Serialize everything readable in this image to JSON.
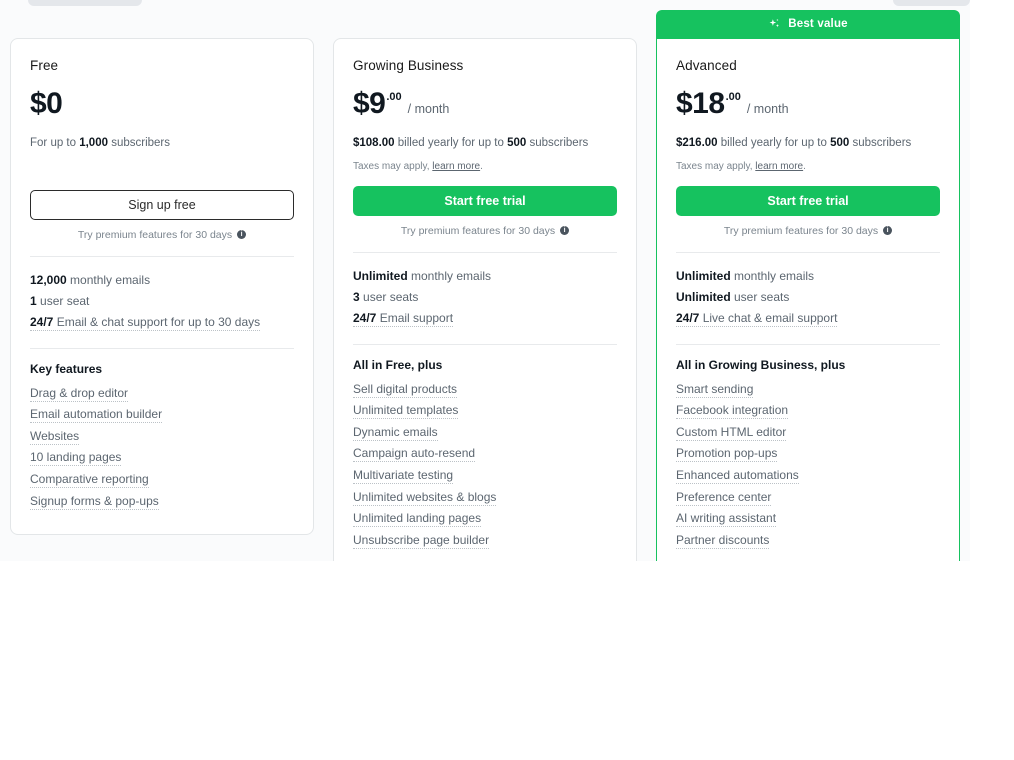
{
  "banner": {
    "label": "Best value",
    "icon": "sparkle-icon",
    "color": "#16c25f"
  },
  "info_icon_glyph": "i",
  "plans": [
    {
      "name": "Free",
      "price_main": "$0",
      "price_cents": "",
      "price_period": "",
      "billing_note_parts": {
        "prefix": "For up to ",
        "amount": "1,000",
        "suffix": " subscribers"
      },
      "tax_note": null,
      "cta_label": "Sign up free",
      "cta_style": "outline",
      "trial_note": "Try premium features for 30 days",
      "specs": [
        {
          "strong": "12,000",
          "rest": " monthly emails",
          "dotted": false
        },
        {
          "strong": "1",
          "rest": " user seat",
          "dotted": false
        },
        {
          "strong": "24/7",
          "rest": " Email & chat support for up to 30 days",
          "dotted": true
        }
      ],
      "features_title": "Key features",
      "features": [
        "Drag & drop editor",
        "Email automation builder",
        "Websites",
        "10 landing pages",
        "Comparative reporting",
        "Signup forms & pop-ups"
      ]
    },
    {
      "name": "Growing Business",
      "price_main": "$9",
      "price_cents": ".00",
      "price_period": "/ month",
      "billing_note_parts": {
        "prefix": "",
        "amount": "$108.00",
        "mid": " billed yearly for up to ",
        "amount2": "500",
        "suffix": " subscribers"
      },
      "tax_note": {
        "text": "Taxes may apply, ",
        "link": "learn more",
        "period": "."
      },
      "cta_label": "Start free trial",
      "cta_style": "solid",
      "trial_note": "Try premium features for 30 days",
      "specs": [
        {
          "strong": "Unlimited",
          "rest": " monthly emails",
          "dotted": false
        },
        {
          "strong": "3",
          "rest": " user seats",
          "dotted": false
        },
        {
          "strong": "24/7",
          "rest": " Email support",
          "dotted": true
        }
      ],
      "features_title": "All in Free, plus",
      "features": [
        "Sell digital products",
        "Unlimited templates",
        "Dynamic emails",
        "Campaign auto-resend",
        "Multivariate testing",
        "Unlimited websites & blogs",
        "Unlimited landing pages",
        "Unsubscribe page builder"
      ]
    },
    {
      "name": "Advanced",
      "price_main": "$18",
      "price_cents": ".00",
      "price_period": "/ month",
      "billing_note_parts": {
        "prefix": "",
        "amount": "$216.00",
        "mid": " billed yearly for up to ",
        "amount2": "500",
        "suffix": " subscribers"
      },
      "tax_note": {
        "text": "Taxes may apply, ",
        "link": "learn more",
        "period": "."
      },
      "cta_label": "Start free trial",
      "cta_style": "solid",
      "trial_note": "Try premium features for 30 days",
      "specs": [
        {
          "strong": "Unlimited",
          "rest": " monthly emails",
          "dotted": false
        },
        {
          "strong": "Unlimited",
          "rest": " user seats",
          "dotted": false
        },
        {
          "strong": "24/7",
          "rest": " Live chat & email support",
          "dotted": true
        }
      ],
      "features_title": "All in Growing Business, plus",
      "features": [
        "Smart sending",
        "Facebook integration",
        "Custom HTML editor",
        "Promotion pop-ups",
        "Enhanced automations",
        "Preference center",
        "AI writing assistant",
        "Partner discounts"
      ]
    }
  ]
}
